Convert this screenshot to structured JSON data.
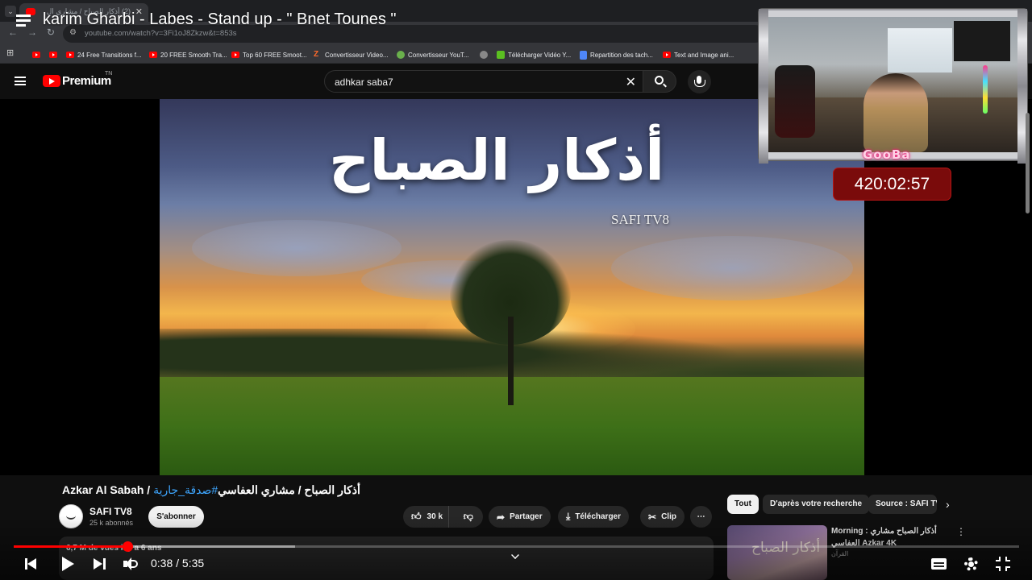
{
  "browser": {
    "tab": {
      "title": "(2) أذكار الصباح / مشاري ال",
      "close": "✕"
    },
    "url": "youtube.com/watch?v=3Fi1oJ8Zkzw&t=853s",
    "bookmarks": [
      {
        "icon": "youtube-icon",
        "label": ""
      },
      {
        "icon": "youtube-icon",
        "label": ""
      },
      {
        "icon": "youtube-icon",
        "label": "24 Free Transitions f..."
      },
      {
        "icon": "youtube-icon",
        "label": "20 FREE Smooth Tra..."
      },
      {
        "icon": "youtube-icon",
        "label": "Top 60 FREE Smoot..."
      },
      {
        "icon": "z-icon",
        "label": "Convertisseur Video..."
      },
      {
        "icon": "converter-icon",
        "label": "Convertisseur YouT..."
      },
      {
        "icon": "globe-icon",
        "label": ""
      },
      {
        "icon": "download-icon",
        "label": "Télécharger Vidéo Y..."
      },
      {
        "icon": "doc-icon",
        "label": "Repartition des tach..."
      },
      {
        "icon": "youtube-icon",
        "label": "Text and Image ani..."
      }
    ]
  },
  "youtube": {
    "brand": "Premium",
    "region": "TN",
    "search": {
      "value": "adhkar saba7"
    }
  },
  "stream": {
    "title": "karim Gharbi - Labes - Stand up - \" Bnet Tounes \"",
    "cam_tag": "GooBa",
    "timer": "420:02:57"
  },
  "video": {
    "overlay_title": "أذكار الصباح",
    "watermark": "SAFI TV8",
    "title_main": "Azkar Al Sabah / أذكار الصباح / مشاري العفاسي",
    "title_hashtag": "#صدقة_جارية",
    "channel": {
      "name": "SAFI TV8",
      "subs": "25 k abonnés"
    },
    "subscribe_label": "S'abonner",
    "likes": "30 k",
    "share_label": "Partager",
    "download_label": "Télécharger",
    "clip_label": "Clip",
    "stats": "6,7 M de vues  il y a 6 ans"
  },
  "player": {
    "current_time": "0:38",
    "separator": " / ",
    "duration": "5:35",
    "progress_fraction": 0.1134,
    "buffered_fraction": 0.28
  },
  "sidebar": {
    "chips": [
      "Tout",
      "D'après votre recherche",
      "Source : SAFI TV8"
    ],
    "recommendation": {
      "thumb_text": "أذكار الصباح",
      "title": "Morning : أذكار الصباح مشاري العفاسي Azkar 4K",
      "channel": "القرآن"
    }
  },
  "colors": {
    "accent": "#ff0000",
    "link": "#3ea6ff",
    "timer_bg": "#7a0b0b"
  }
}
